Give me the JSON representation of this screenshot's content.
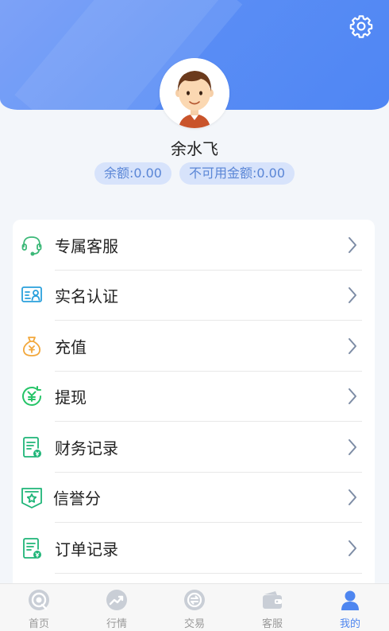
{
  "user": {
    "name": "余水飞",
    "balance": "余额:0.00",
    "unavailable": "不可用金额:0.00"
  },
  "menu": [
    {
      "label": "专属客服",
      "icon": "headset-icon"
    },
    {
      "label": "实名认证",
      "icon": "id-card-icon"
    },
    {
      "label": "充值",
      "icon": "money-bag-icon"
    },
    {
      "label": "提现",
      "icon": "yuan-withdraw-icon"
    },
    {
      "label": "财务记录",
      "icon": "finance-record-icon"
    },
    {
      "label": "信誉分",
      "icon": "credit-star-icon"
    },
    {
      "label": "订单记录",
      "icon": "order-record-icon"
    }
  ],
  "tabs": [
    {
      "label": "首页",
      "icon": "home-icon",
      "active": false
    },
    {
      "label": "行情",
      "icon": "trend-icon",
      "active": false
    },
    {
      "label": "交易",
      "icon": "exchange-icon",
      "active": false
    },
    {
      "label": "客服",
      "icon": "wallet-icon",
      "active": false
    },
    {
      "label": "我的",
      "icon": "user-icon",
      "active": true
    }
  ],
  "colors": {
    "brand": "#5b8ef5",
    "tab_active": "#4e86f0",
    "tab_inactive": "#999999",
    "badge_bg": "#d7e3fb",
    "badge_text": "#5a86d6"
  }
}
